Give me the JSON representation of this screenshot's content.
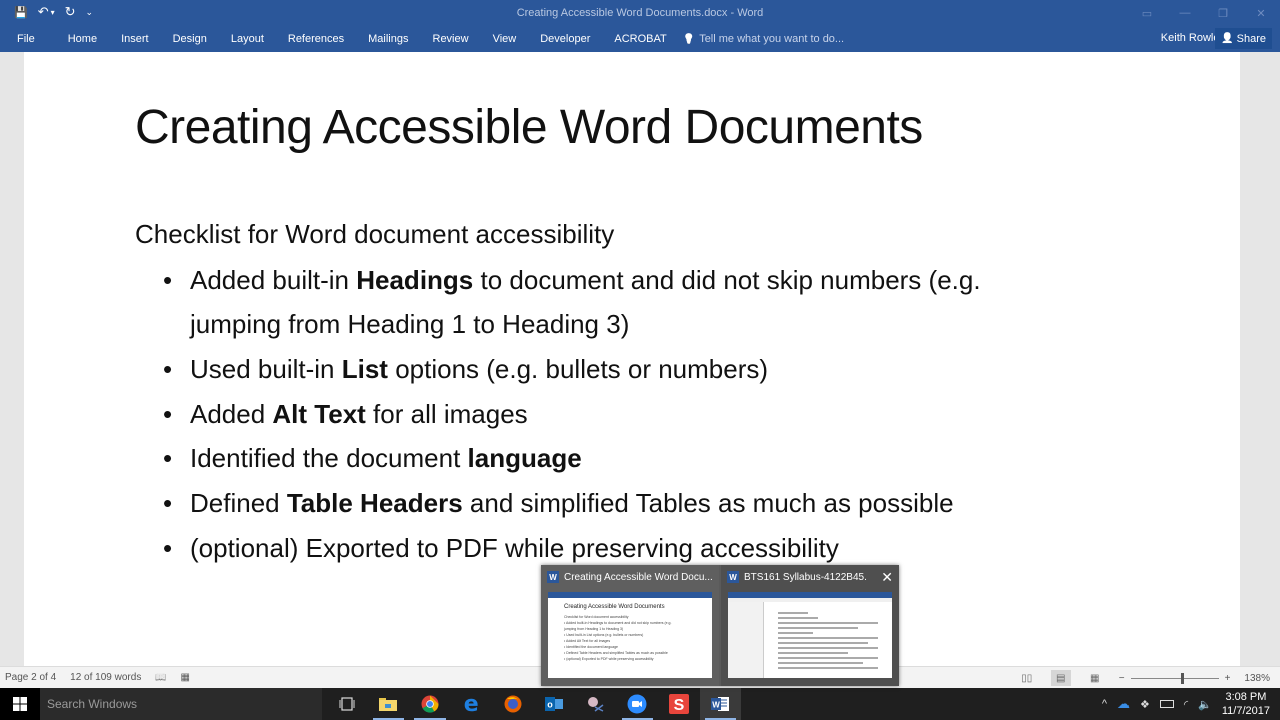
{
  "titlebar": {
    "title": "Creating Accessible Word Documents.docx - Word",
    "qat": {
      "save_icon": "💾",
      "undo_icon": "↶",
      "undo_dropdown": "▾",
      "redo_icon": "↻",
      "customize": "⌄"
    },
    "window_controls": {
      "ribbon_display": "▭",
      "minimize": "—",
      "restore": "❐",
      "close": "✕"
    }
  },
  "ribbon": {
    "tabs": [
      "File",
      "Home",
      "Insert",
      "Design",
      "Layout",
      "References",
      "Mailings",
      "Review",
      "View",
      "Developer",
      "ACROBAT"
    ],
    "tell_me": {
      "icon": "💡",
      "placeholder": "Tell me what you want to do..."
    },
    "user_name": "Keith Rowley",
    "share": {
      "icon": "👤",
      "label": "Share"
    }
  },
  "document": {
    "title": "Creating Accessible Word Documents",
    "subtitle": "Checklist for Word document accessibility",
    "items": [
      {
        "before": "Added built-in ",
        "bold": "Headings",
        "after": " to document and did not skip numbers (e.g. jumping from Heading 1 to Heading 3)"
      },
      {
        "before": "Used built-in ",
        "bold": "List",
        "after": " options (e.g. bullets or numbers)"
      },
      {
        "before": "Added ",
        "bold": "Alt Text",
        "after": " for all images"
      },
      {
        "before": "Identified the document ",
        "bold": "language",
        "after": ""
      },
      {
        "before": "Defined ",
        "bold": "Table Headers",
        "after": " and simplified Tables as much as possible"
      },
      {
        "before": "(optional) Exported to PDF while preserving accessibility",
        "bold": "",
        "after": ""
      }
    ]
  },
  "statusbar": {
    "page": "Page 2 of 4",
    "words": "12 of 109 words",
    "proofing_icon": "📖",
    "macro_icon": "▦",
    "views": [
      "Read Mode",
      "Print Layout",
      "Web Layout"
    ],
    "zoom_out": "−",
    "zoom_in": "+",
    "zoom_level": "138%",
    "zoom_percent": 138
  },
  "taskbar": {
    "search_placeholder": "Search Windows",
    "apps": [
      "Task View",
      "File Explorer",
      "Google Chrome",
      "Microsoft Edge",
      "Firefox",
      "Outlook",
      "Snipping Tool",
      "Zoom",
      "Snagit",
      "Word"
    ],
    "time": "3:08 PM",
    "date": "11/7/2017"
  },
  "preview": {
    "windows": [
      {
        "title": "Creating Accessible Word Docu...",
        "badge": "W"
      },
      {
        "title": "BTS161 Syllabus-4122B45...",
        "badge": "W",
        "close": "✕"
      }
    ],
    "mini_title": "Creating Accessible Word Documents",
    "mini_lines": [
      "Checklist for Word document accessibility",
      "• Added built-in Headings to document and did not skip numbers (e.g.",
      "  jumping from Heading 1 to Heading 3)",
      "• Used built-in List options (e.g. bullets or numbers)",
      "• Added Alt Text for all images",
      "• Identified the document language",
      "• Defined Table Headers and simplified Tables as much as possible",
      "• (optional) Exported to PDF while preserving accessibility"
    ]
  }
}
